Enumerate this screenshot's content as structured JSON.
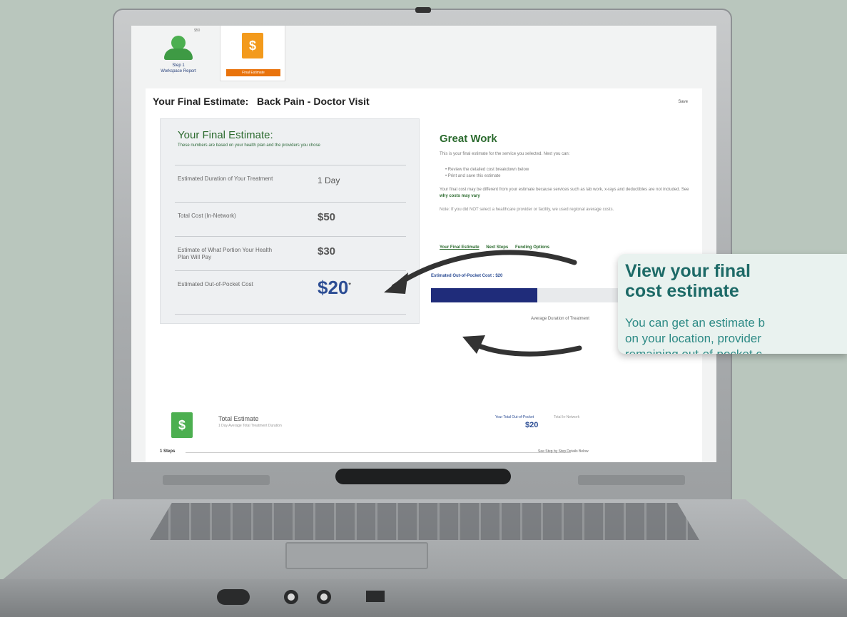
{
  "steps": {
    "step1_badge": "$50",
    "step1_label_line1": "Step 1",
    "step1_label_line2": "Workspace Report",
    "step2_icon": "$",
    "step2_label": "Final Estimate"
  },
  "page": {
    "title": "Your Final Estimate:   Back Pain - Doctor Visit",
    "save": "Save"
  },
  "estimate": {
    "title": "Your Final Estimate:",
    "subtitle": "These numbers are based on your health plan and the providers you chose",
    "rows": [
      {
        "label": "Estimated Duration of Your Treatment",
        "value": "1 Day"
      },
      {
        "label": "Total Cost (In-Network)",
        "value": "$50"
      },
      {
        "label": "Estimate of What Portion Your Health Plan Will Pay",
        "value": "$30"
      },
      {
        "label": "Estimated Out-of-Pocket Cost",
        "value": "$20",
        "footnote": "*"
      }
    ]
  },
  "great_work": {
    "title": "Great Work",
    "text": "This is your final estimate for the service you selected. Next you can:",
    "bullets": [
      "Review the detailed cost breakdown below",
      "Print and save this estimate"
    ],
    "text2": "Your final cost may be different from your estimate because services such as lab work, x-rays and deductibles are not included. See",
    "link": "why costs may vary",
    "note": "Note: If you did NOT select a healthcare provider or facility, we used regional average costs.",
    "tabs": [
      "Your Final Estimate",
      "Next Steps",
      "Funding Options"
    ],
    "oop": "Estimated Out-of-Pocket Cost : $20",
    "progress": 0.4,
    "avg_duration": "Average Duration of Treatment"
  },
  "total": {
    "icon": "$",
    "title": "Total Estimate",
    "subtitle": "1 Day Average Total Treatment Duration",
    "oop_label": "Your Total Out-of-Pocket",
    "oop_value": "$20",
    "label2": "Total In-Network",
    "steps_count": "1 Steps",
    "details_link": "See Step by Step Details Below"
  },
  "callout": {
    "title_line1": "View your final",
    "title_line2": "cost estimate",
    "body_line1": "You can get an estimate b",
    "body_line2": "on your location, provider",
    "body_line3": "remaining out-of-pocket c"
  },
  "colors": {
    "accent_green": "#2c6b2f",
    "accent_blue": "#2c4d94",
    "callout_teal": "#1d6a67",
    "progress_fill": "#1f2c7a",
    "tab_orange": "#e9730c"
  }
}
